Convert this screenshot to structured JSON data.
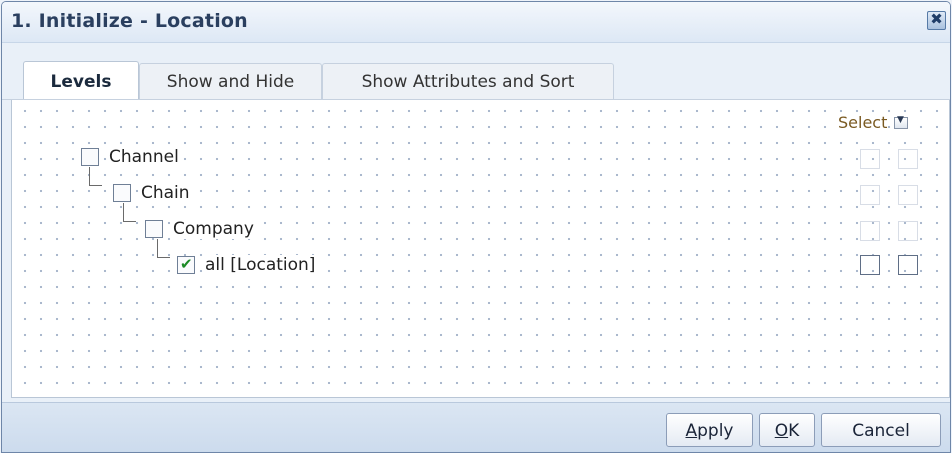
{
  "dialog": {
    "title": "1. Initialize - Location",
    "close_glyph": "✖"
  },
  "tabs": [
    {
      "label": "Levels",
      "active": true
    },
    {
      "label": "Show and Hide",
      "active": false
    },
    {
      "label": "Show Attributes and Sort",
      "active": false
    }
  ],
  "levels": {
    "select_header": "Select",
    "select_dropdown_glyph": "▼",
    "tree": [
      {
        "label": "Channel",
        "checked": false,
        "depth": 0
      },
      {
        "label": "Chain",
        "checked": false,
        "depth": 1
      },
      {
        "label": "Company",
        "checked": false,
        "depth": 2
      },
      {
        "label": "all [Location]",
        "checked": true,
        "depth": 3
      }
    ],
    "check_glyph": "✔"
  },
  "footer": {
    "apply_first": "A",
    "apply_rest": "pply",
    "ok_first": "O",
    "ok_rest": "K",
    "cancel_label": "Cancel"
  },
  "colors": {
    "check": "#1b8a26",
    "title_text": "#2a3f5f",
    "select_header": "#7a5a22"
  }
}
